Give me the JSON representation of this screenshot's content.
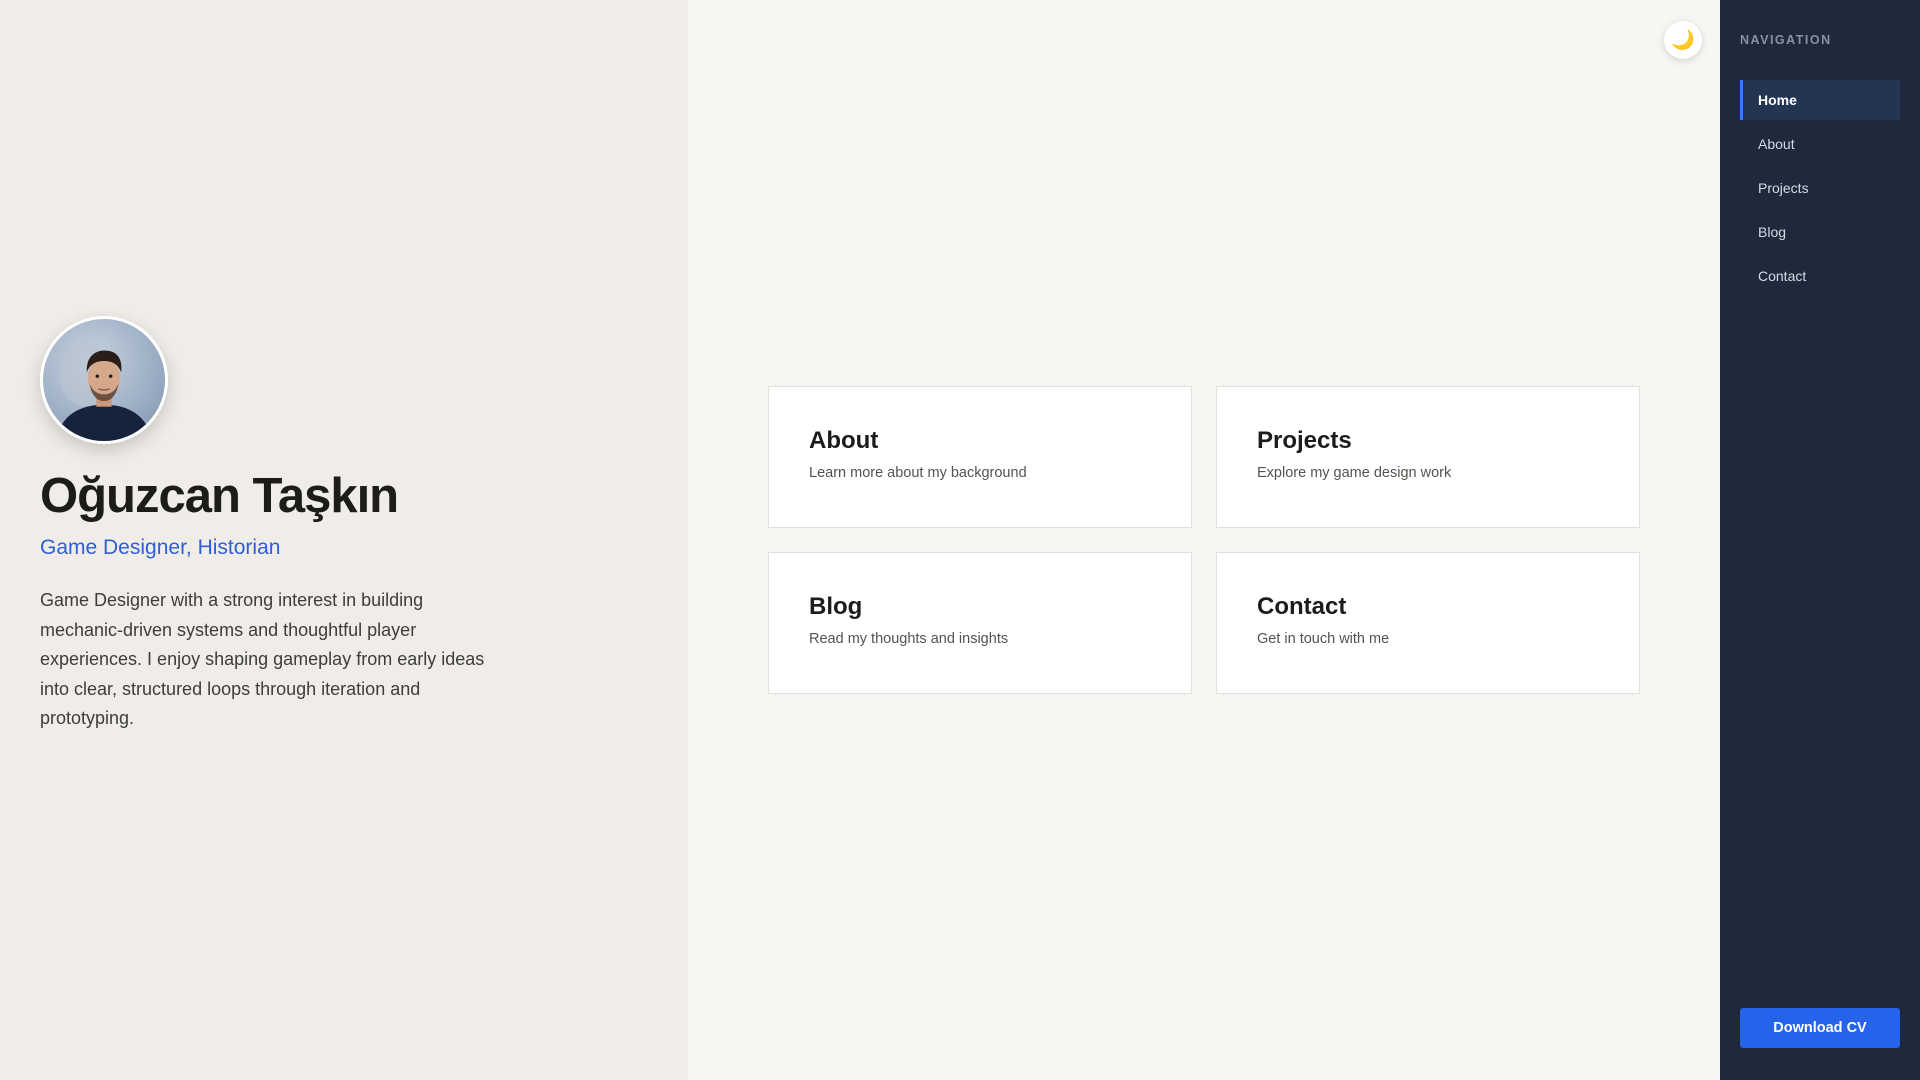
{
  "profile": {
    "name": "Oğuzcan Taşkın",
    "role": "Game Designer, Historian",
    "bio": "Game Designer with a strong interest in building mechanic-driven systems and thoughtful player experiences. I enjoy shaping gameplay from early ideas into clear, structured loops through iteration and prototyping."
  },
  "theme_toggle": {
    "icon": "moon-icon",
    "glyph": "🌙"
  },
  "cards": [
    {
      "title": "About",
      "description": "Learn more about my background"
    },
    {
      "title": "Projects",
      "description": "Explore my game design work"
    },
    {
      "title": "Blog",
      "description": "Read my thoughts and insights"
    },
    {
      "title": "Contact",
      "description": "Get in touch with me"
    }
  ],
  "nav": {
    "heading": "NAVIGATION",
    "items": [
      {
        "label": "Home",
        "active": true
      },
      {
        "label": "About",
        "active": false
      },
      {
        "label": "Projects",
        "active": false
      },
      {
        "label": "Blog",
        "active": false
      },
      {
        "label": "Contact",
        "active": false
      }
    ],
    "download_label": "Download CV"
  },
  "colors": {
    "accent": "#2563eb",
    "nav_background": "#1e2a3c",
    "role_text": "#2d5fd6"
  }
}
